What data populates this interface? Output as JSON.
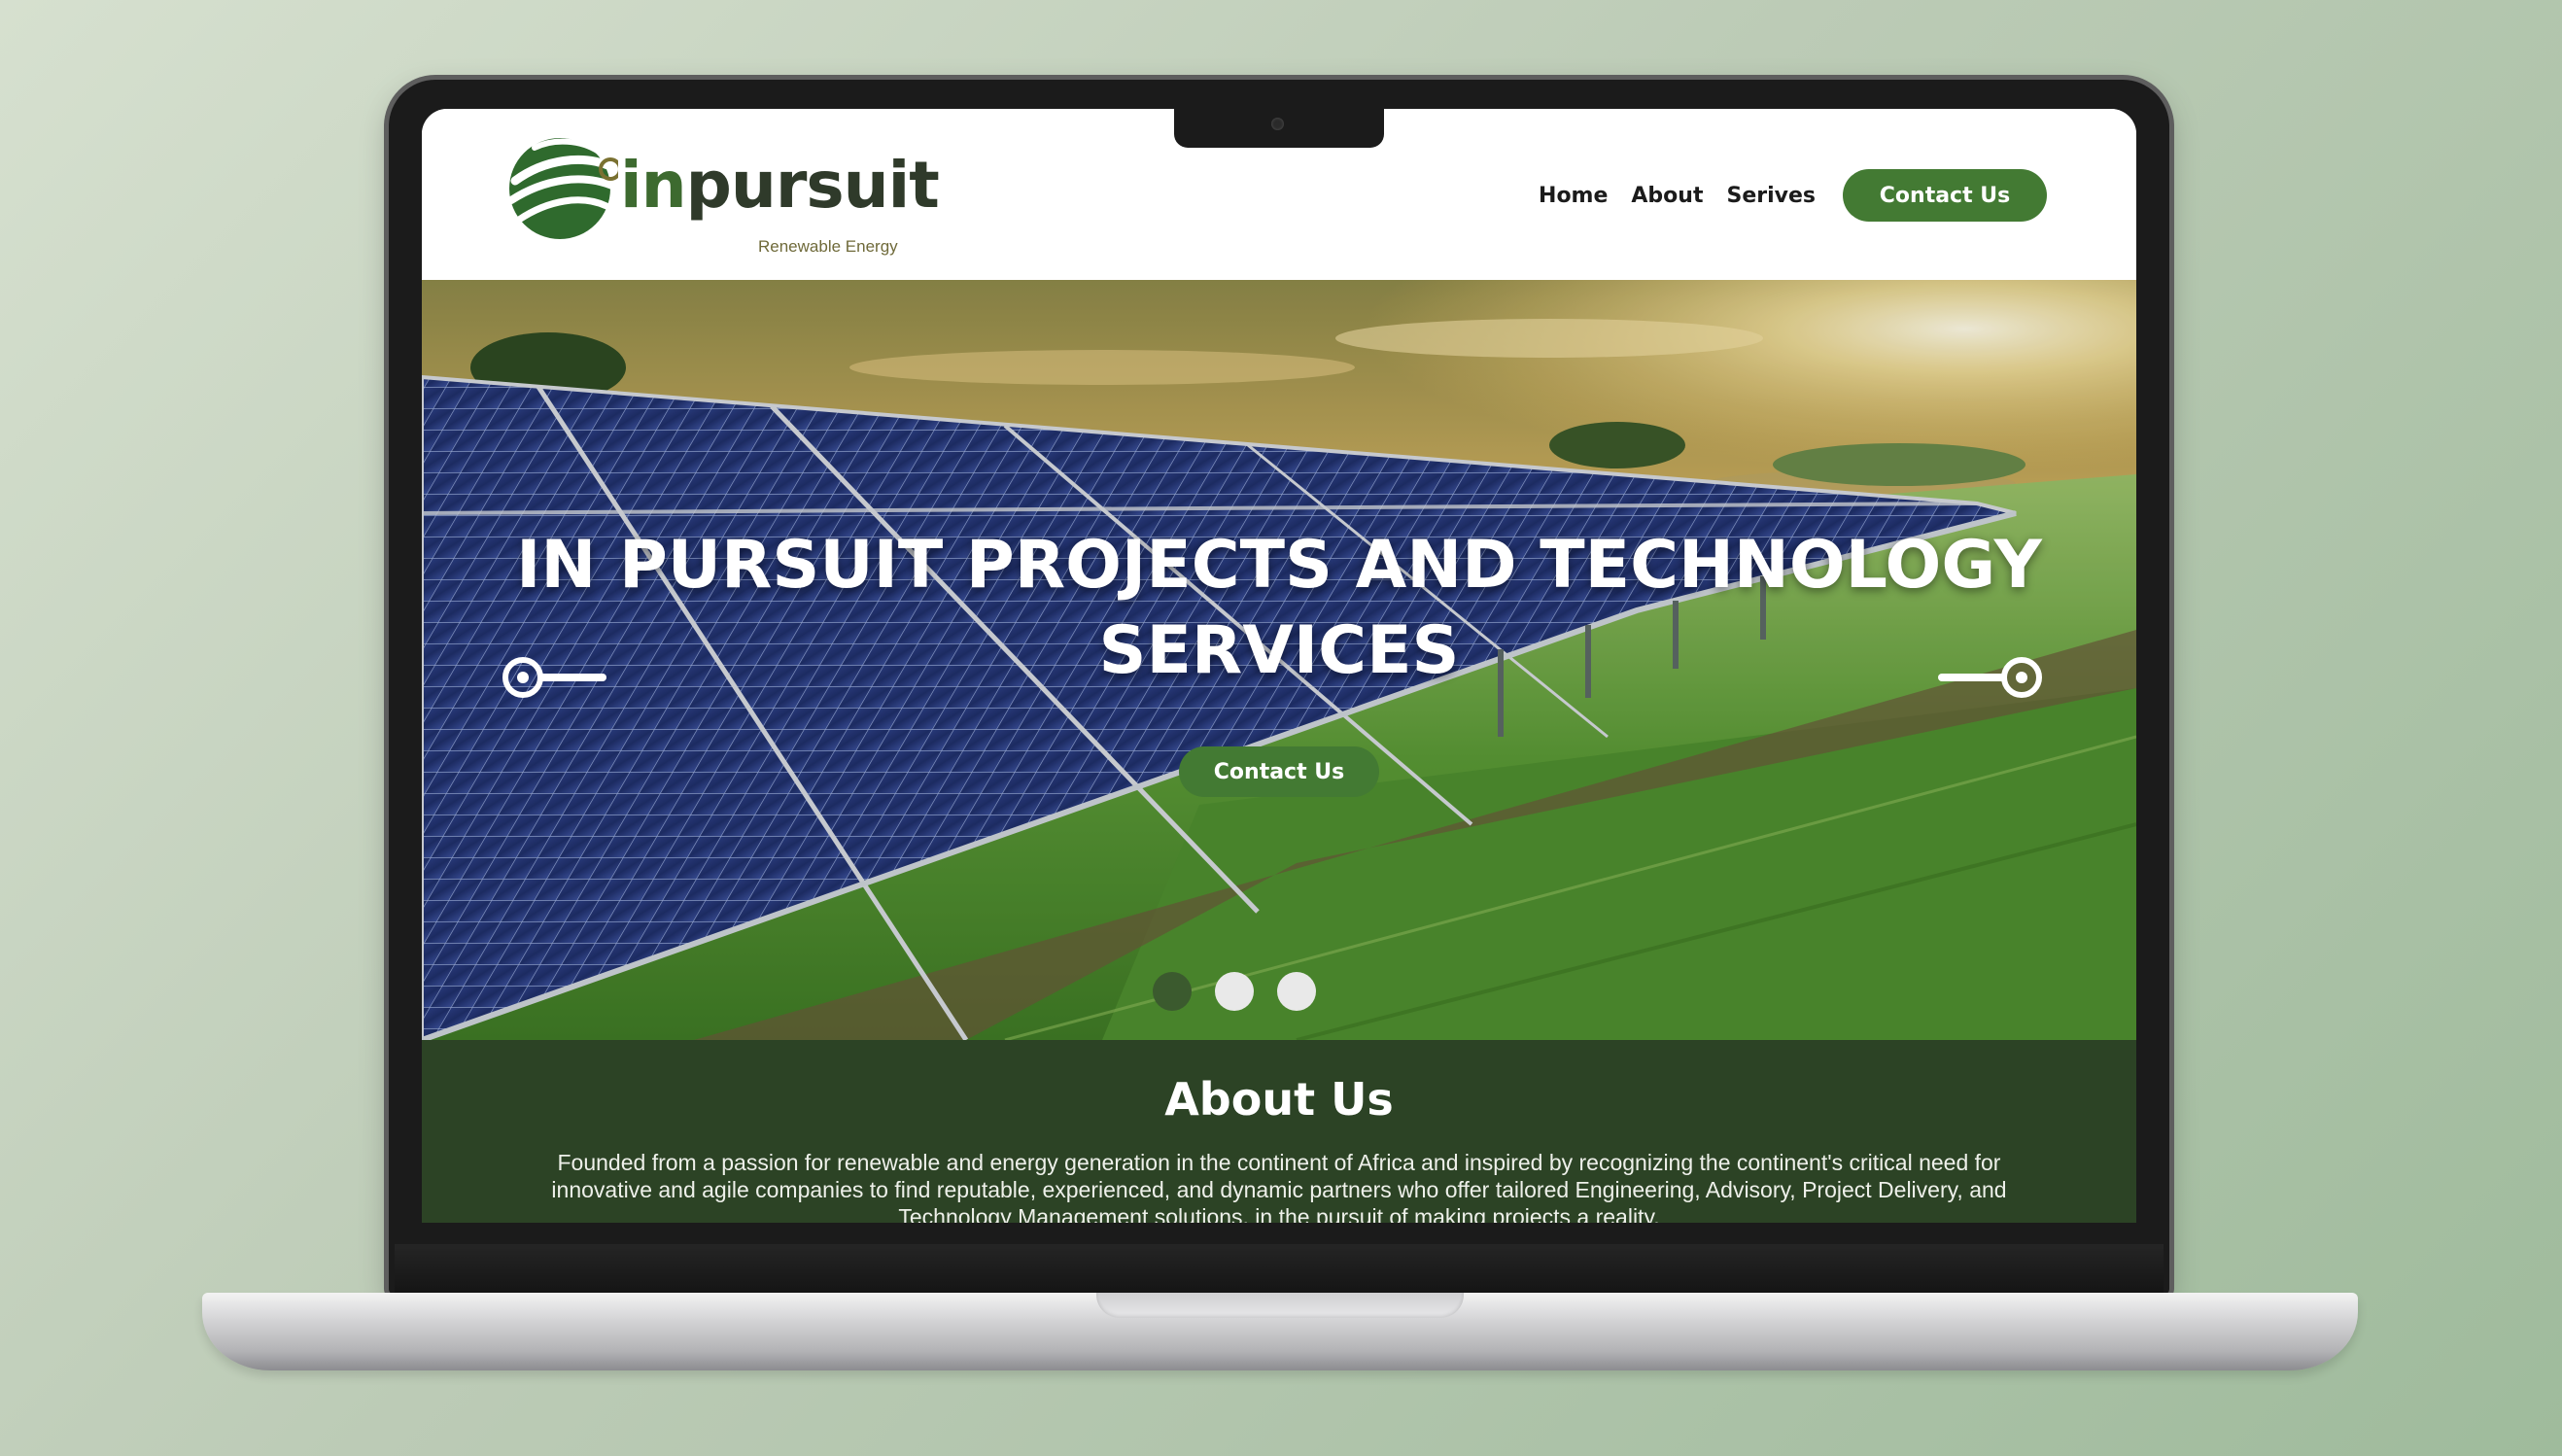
{
  "brand": {
    "name_prefix": "in",
    "name_main": "pursuit",
    "tagline": "Renewable Energy"
  },
  "nav": {
    "items": [
      {
        "label": "Home"
      },
      {
        "label": "About"
      },
      {
        "label": "Serives"
      }
    ],
    "cta_label": "Contact Us"
  },
  "hero": {
    "title": "IN PURSUIT PROJECTS AND TECHNOLOGY SERVICES",
    "cta_label": "Contact Us",
    "slides_total": 3,
    "active_slide": 1
  },
  "about": {
    "title": "About Us",
    "body": "Founded from a passion for renewable and energy generation in the continent of Africa and inspired by recognizing the continent's critical need for innovative and agile companies to find reputable, experienced, and dynamic partners who offer tailored Engineering, Advisory, Project Delivery, and Technology Management solutions, in the pursuit of making projects a reality."
  },
  "colors": {
    "brand_green": "#437a33",
    "about_bg": "#2c4325",
    "active_dot": "#3b5a2e",
    "laptop_bezel": "#1b1b1b"
  },
  "icons": {
    "prev": "slider-prev-icon",
    "next": "slider-next-icon",
    "logo": "leaf-globe-logo-icon"
  }
}
